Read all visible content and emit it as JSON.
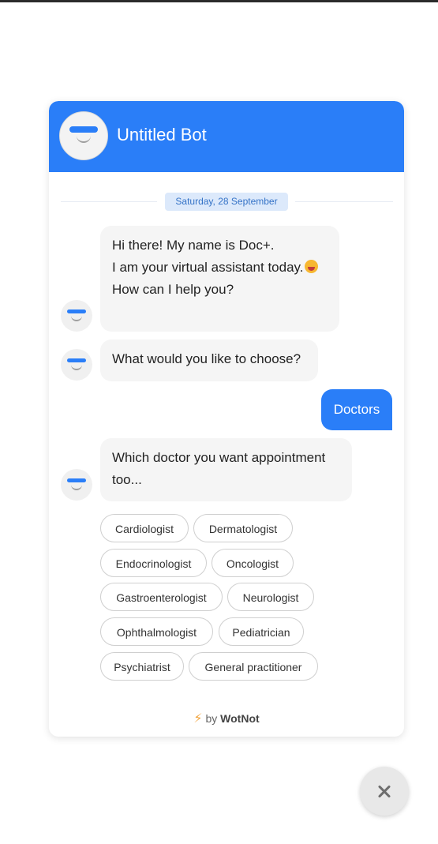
{
  "header": {
    "title": "Untitled Bot",
    "accent_color": "#2a7ef8"
  },
  "chat": {
    "date": "Saturday, 28 September",
    "messages": [
      {
        "sender": "bot",
        "lines": [
          "Hi there! My name is Doc+.",
          "I am your virtual assistant today.",
          "How can I help you?"
        ],
        "emoji": "grinning-face-emoji"
      },
      {
        "sender": "bot",
        "lines": [
          "What would you like to choose?"
        ]
      },
      {
        "sender": "user",
        "text": "Doctors"
      },
      {
        "sender": "bot",
        "lines": [
          "Which doctor you want appointment",
          "too..."
        ]
      }
    ],
    "options": [
      "Cardiologist",
      "Dermatologist",
      "Endocrinologist",
      "Oncologist",
      "Gastroenterologist",
      "Neurologist",
      "Ophthalmologist",
      "Pediatrician",
      "Psychiatrist",
      "General practitioner"
    ]
  },
  "footer": {
    "prefix": "by",
    "brand": "WotNot",
    "icon": "lightning-icon"
  },
  "launcher": {
    "icon": "close-icon"
  }
}
